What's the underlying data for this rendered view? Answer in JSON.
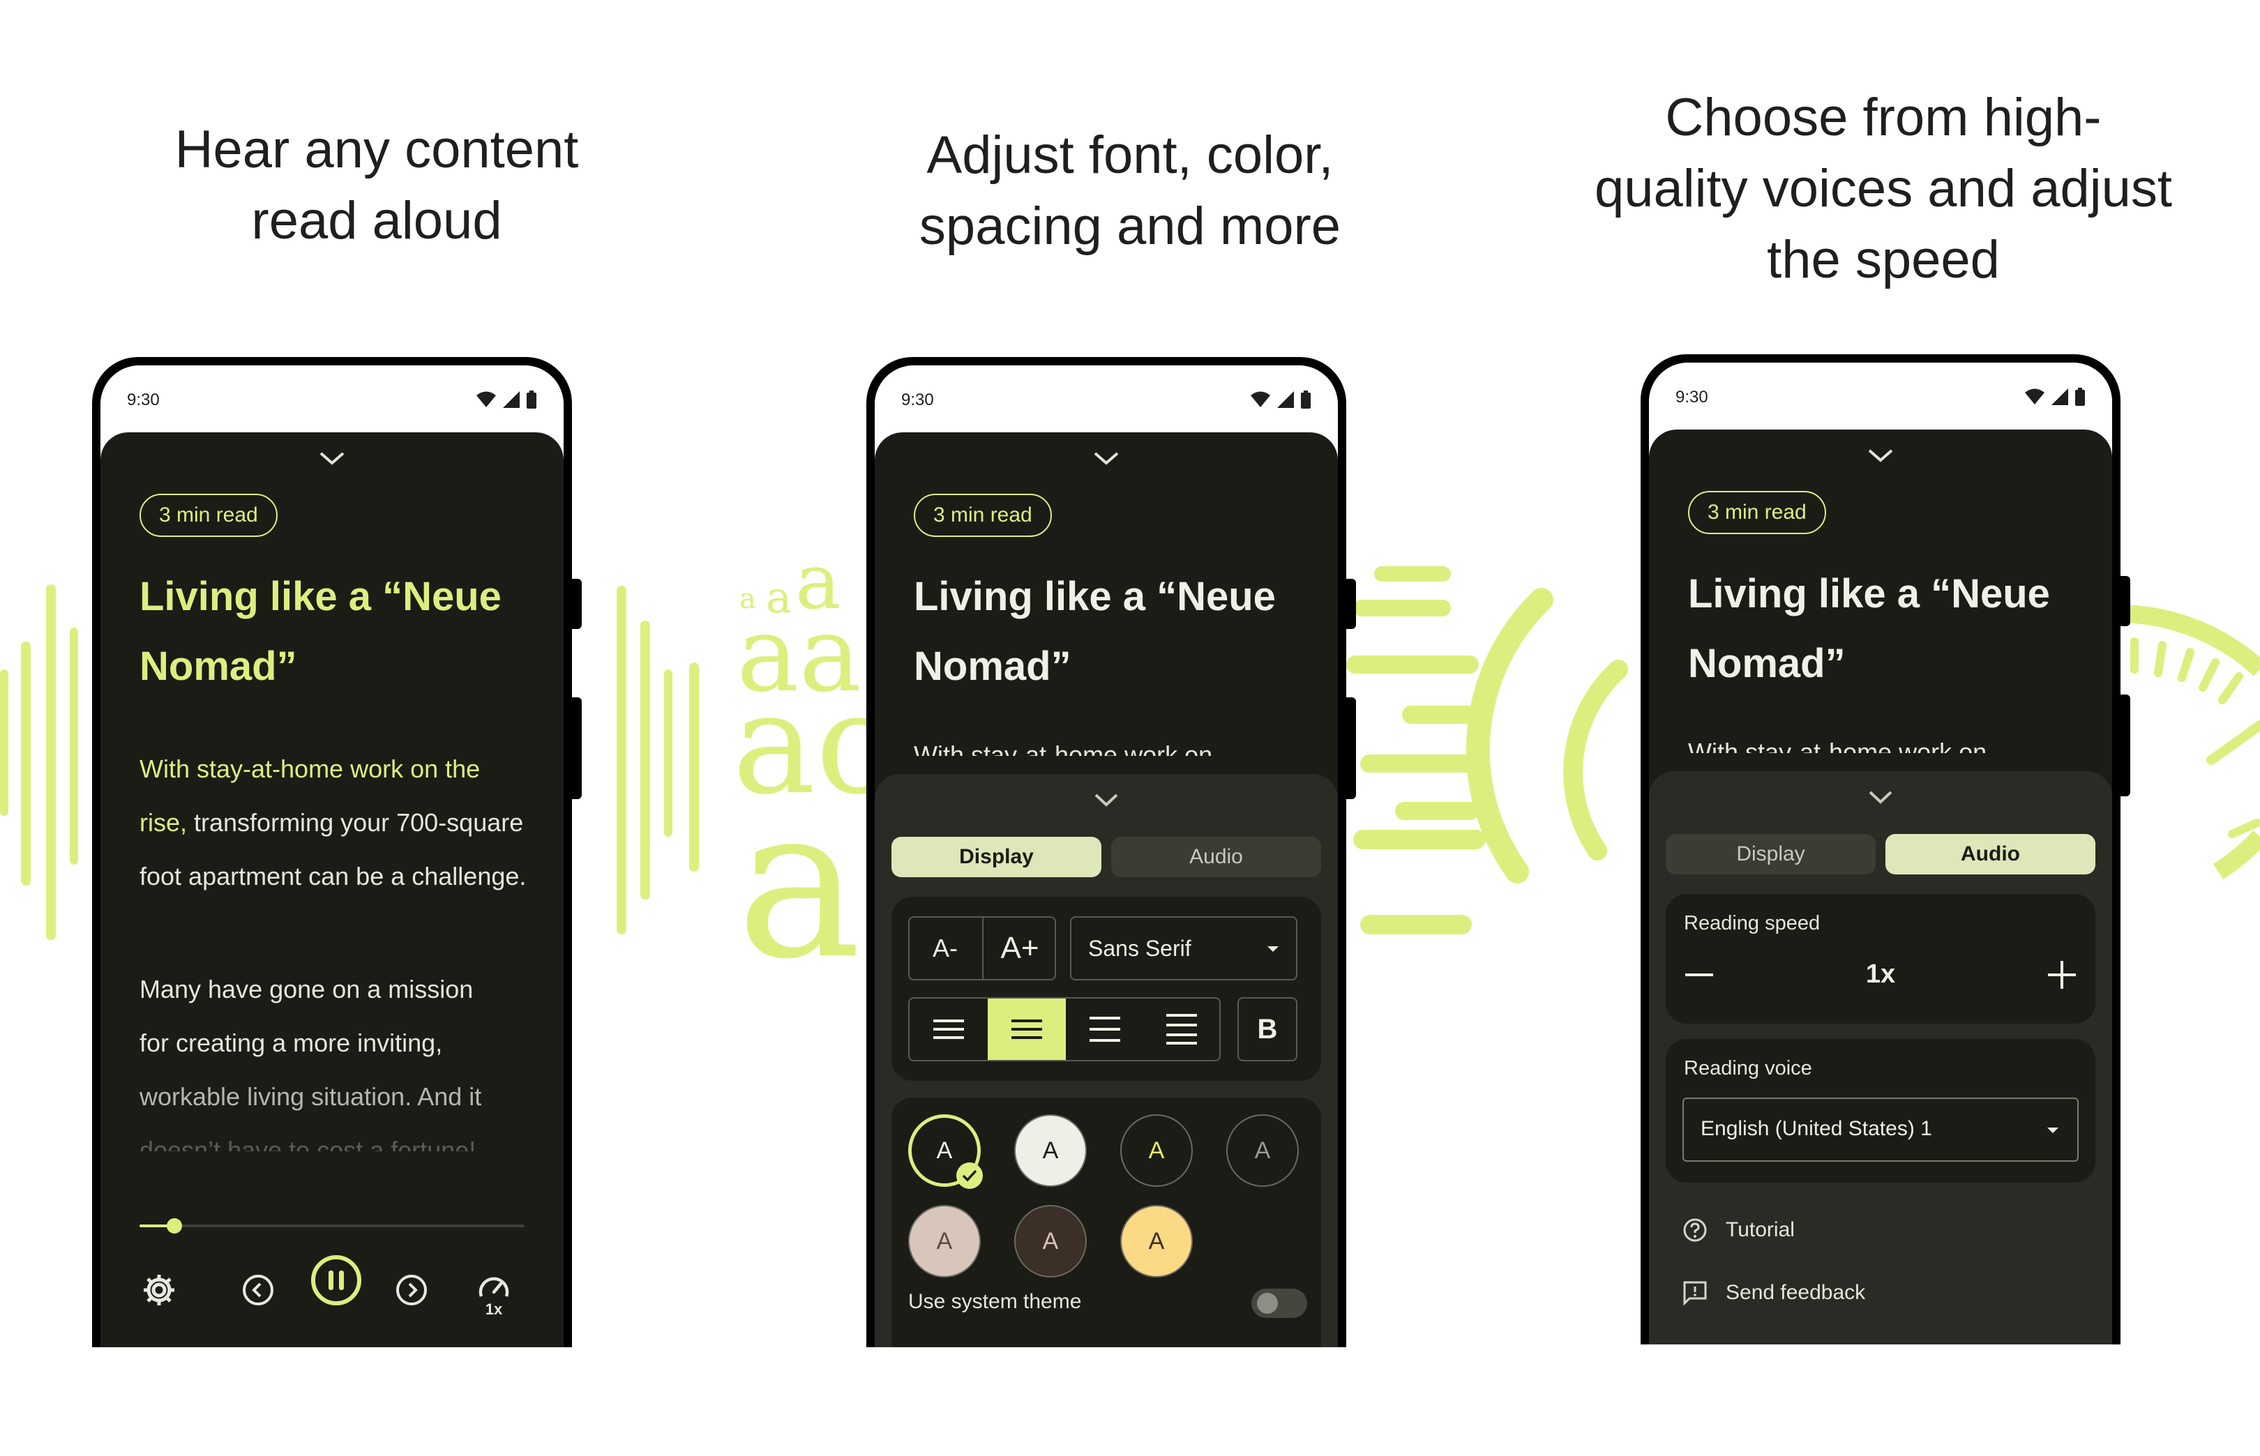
{
  "captions": {
    "c1": "Hear any content\nread aloud",
    "c2": "Adjust font, color,\nspacing and more",
    "c3": "Choose from high-\nquality voices and adjust\nthe speed"
  },
  "status": {
    "time": "9:30"
  },
  "article": {
    "chip": "3 min read",
    "title": "Living like a “Neue Nomad”",
    "p1_highlight": "With stay-at-home work on the rise,",
    "p1_rest": " transforming your 700-square foot apartment can be a challenge.",
    "p1_line1": "With stay-at-home work on",
    "p2_l1": "Many have gone on a mission",
    "p2_l2": "for creating a more inviting,",
    "p2_l3": "workable living situation. And it",
    "p2_l4": "doesn’t have to cost a fortune!"
  },
  "player": {
    "progress": 0.09,
    "speed_label": "1x"
  },
  "tabs": {
    "display": "Display",
    "audio": "Audio"
  },
  "display_settings": {
    "font_decrease": "A-",
    "font_increase": "A+",
    "font_family": "Sans Serif",
    "bold": "B",
    "swatch_letter": "A",
    "swatches": [
      {
        "bg": "#1c1c17",
        "fg": "#f2f2e6",
        "selected": true
      },
      {
        "bg": "#f0efe6",
        "fg": "#1c1c17",
        "selected": false
      },
      {
        "bg": "#1c1c17",
        "fg": "#e8ef67",
        "selected": false
      },
      {
        "bg": "#1c1c17",
        "fg": "#9a9a92",
        "selected": false
      },
      {
        "bg": "#d9c6bb",
        "fg": "#5a4a42",
        "selected": false
      },
      {
        "bg": "#3b2f27",
        "fg": "#d9c6bb",
        "selected": false
      },
      {
        "bg": "#fcd984",
        "fg": "#3b2f27",
        "selected": false
      }
    ],
    "system_theme_label": "Use system theme"
  },
  "audio_settings": {
    "reading_speed_label": "Reading speed",
    "speed_value": "1x",
    "reading_voice_label": "Reading voice",
    "voice_value": "English (United States) 1",
    "tutorial": "Tutorial",
    "send_feedback": "Send feedback"
  },
  "colors": {
    "accent": "#dcef7e",
    "background": "#1c1c17",
    "sheet": "#2b2b25"
  }
}
